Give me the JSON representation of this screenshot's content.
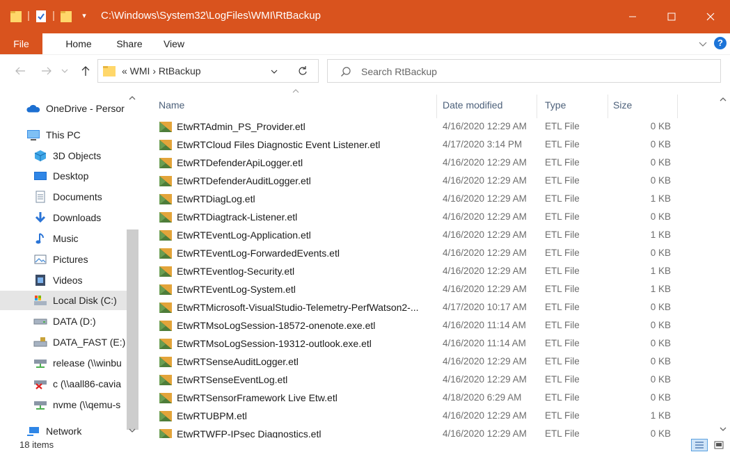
{
  "window": {
    "title": "C:\\Windows\\System32\\LogFiles\\WMI\\RtBackup",
    "accent_color": "#d9531e"
  },
  "ribbon": {
    "tabs": [
      "File",
      "Home",
      "Share",
      "View"
    ]
  },
  "address_bar": {
    "path_text": "«  WMI  ›  RtBackup"
  },
  "search": {
    "placeholder": "Search RtBackup"
  },
  "sidebar": {
    "items": [
      {
        "label": "OneDrive - Persor",
        "icon": "onedrive-icon"
      },
      {
        "label": "This PC",
        "icon": "this-pc-icon"
      },
      {
        "label": "3D Objects",
        "icon": "3d-objects-icon"
      },
      {
        "label": "Desktop",
        "icon": "desktop-icon"
      },
      {
        "label": "Documents",
        "icon": "documents-icon"
      },
      {
        "label": "Downloads",
        "icon": "downloads-icon"
      },
      {
        "label": "Music",
        "icon": "music-icon"
      },
      {
        "label": "Pictures",
        "icon": "pictures-icon"
      },
      {
        "label": "Videos",
        "icon": "videos-icon"
      },
      {
        "label": "Local Disk (C:)",
        "icon": "local-disk-icon",
        "selected": true
      },
      {
        "label": "DATA (D:)",
        "icon": "drive-icon"
      },
      {
        "label": "DATA_FAST (E:)",
        "icon": "drive-locked-icon"
      },
      {
        "label": "release (\\\\winbu",
        "icon": "network-drive-icon"
      },
      {
        "label": "c (\\\\aall86-cavia",
        "icon": "network-drive-disconnected-icon"
      },
      {
        "label": "nvme (\\\\qemu-s",
        "icon": "network-drive-icon"
      },
      {
        "label": "Network",
        "icon": "network-icon"
      }
    ]
  },
  "columns": {
    "name": "Name",
    "date": "Date modified",
    "type": "Type",
    "size": "Size"
  },
  "files": [
    {
      "name": "EtwRTAdmin_PS_Provider.etl",
      "date": "4/16/2020 12:29 AM",
      "type": "ETL File",
      "size": "0 KB"
    },
    {
      "name": "EtwRTCloud Files Diagnostic Event Listener.etl",
      "date": "4/17/2020 3:14 PM",
      "type": "ETL File",
      "size": "0 KB"
    },
    {
      "name": "EtwRTDefenderApiLogger.etl",
      "date": "4/16/2020 12:29 AM",
      "type": "ETL File",
      "size": "0 KB"
    },
    {
      "name": "EtwRTDefenderAuditLogger.etl",
      "date": "4/16/2020 12:29 AM",
      "type": "ETL File",
      "size": "0 KB"
    },
    {
      "name": "EtwRTDiagLog.etl",
      "date": "4/16/2020 12:29 AM",
      "type": "ETL File",
      "size": "1 KB"
    },
    {
      "name": "EtwRTDiagtrack-Listener.etl",
      "date": "4/16/2020 12:29 AM",
      "type": "ETL File",
      "size": "0 KB"
    },
    {
      "name": "EtwRTEventLog-Application.etl",
      "date": "4/16/2020 12:29 AM",
      "type": "ETL File",
      "size": "1 KB"
    },
    {
      "name": "EtwRTEventLog-ForwardedEvents.etl",
      "date": "4/16/2020 12:29 AM",
      "type": "ETL File",
      "size": "0 KB"
    },
    {
      "name": "EtwRTEventlog-Security.etl",
      "date": "4/16/2020 12:29 AM",
      "type": "ETL File",
      "size": "1 KB"
    },
    {
      "name": "EtwRTEventLog-System.etl",
      "date": "4/16/2020 12:29 AM",
      "type": "ETL File",
      "size": "1 KB"
    },
    {
      "name": "EtwRTMicrosoft-VisualStudio-Telemetry-PerfWatson2-...",
      "date": "4/17/2020 10:17 AM",
      "type": "ETL File",
      "size": "0 KB"
    },
    {
      "name": "EtwRTMsoLogSession-18572-onenote.exe.etl",
      "date": "4/16/2020 11:14 AM",
      "type": "ETL File",
      "size": "0 KB"
    },
    {
      "name": "EtwRTMsoLogSession-19312-outlook.exe.etl",
      "date": "4/16/2020 11:14 AM",
      "type": "ETL File",
      "size": "0 KB"
    },
    {
      "name": "EtwRTSenseAuditLogger.etl",
      "date": "4/16/2020 12:29 AM",
      "type": "ETL File",
      "size": "0 KB"
    },
    {
      "name": "EtwRTSenseEventLog.etl",
      "date": "4/16/2020 12:29 AM",
      "type": "ETL File",
      "size": "0 KB"
    },
    {
      "name": "EtwRTSensorFramework Live Etw.etl",
      "date": "4/18/2020 6:29 AM",
      "type": "ETL File",
      "size": "0 KB"
    },
    {
      "name": "EtwRTUBPM.etl",
      "date": "4/16/2020 12:29 AM",
      "type": "ETL File",
      "size": "1 KB"
    },
    {
      "name": "EtwRTWFP-IPsec Diagnostics.etl",
      "date": "4/16/2020 12:29 AM",
      "type": "ETL File",
      "size": "0 KB"
    }
  ],
  "status": {
    "item_count": "18 items"
  }
}
